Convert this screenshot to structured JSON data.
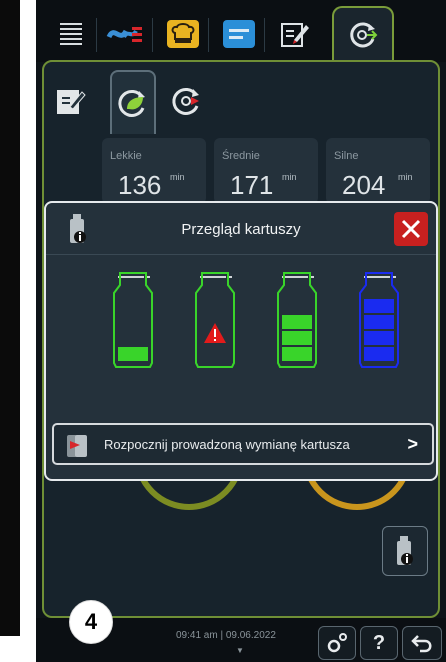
{
  "tabs": [
    {
      "icon": "menu-icon"
    },
    {
      "icon": "steam-heat-icon"
    },
    {
      "icon": "chef-hat-icon"
    },
    {
      "icon": "tray-icon"
    },
    {
      "icon": "edit-icon"
    },
    {
      "icon": "carecontrol-icon",
      "active": true
    }
  ],
  "subtabs": [
    {
      "icon": "edit-icon"
    },
    {
      "icon": "clean-eco-icon",
      "active": true
    },
    {
      "icon": "clean-forward-icon"
    }
  ],
  "programs": [
    {
      "label": "Lekkie",
      "value": "136",
      "unit": "min"
    },
    {
      "label": "Średnie",
      "value": "171",
      "unit": "min"
    },
    {
      "label": "Silne",
      "value": "204",
      "unit": "min"
    }
  ],
  "modal": {
    "title": "Przegląd kartuszy",
    "cartridges": [
      {
        "color": "#39d42a",
        "fill_level": 0.33,
        "warning": false
      },
      {
        "color": "#39d42a",
        "fill_level": 0.0,
        "warning": true
      },
      {
        "color": "#39d42a",
        "fill_level": 0.66,
        "warning": false
      },
      {
        "color": "#1a2bf0",
        "fill_level": 1.0,
        "warning": false
      }
    ],
    "action_label": "Rozpocznij prowadzoną wymianę kartusza",
    "action_chevron": ">"
  },
  "status": {
    "time": "09:41 am | 09.06.2022"
  },
  "bottom_buttons": {
    "help_label": "?"
  },
  "step_number": "4",
  "colors": {
    "accent": "#7a9c3a",
    "close": "#c8201f",
    "warning": "#e21b1b"
  }
}
